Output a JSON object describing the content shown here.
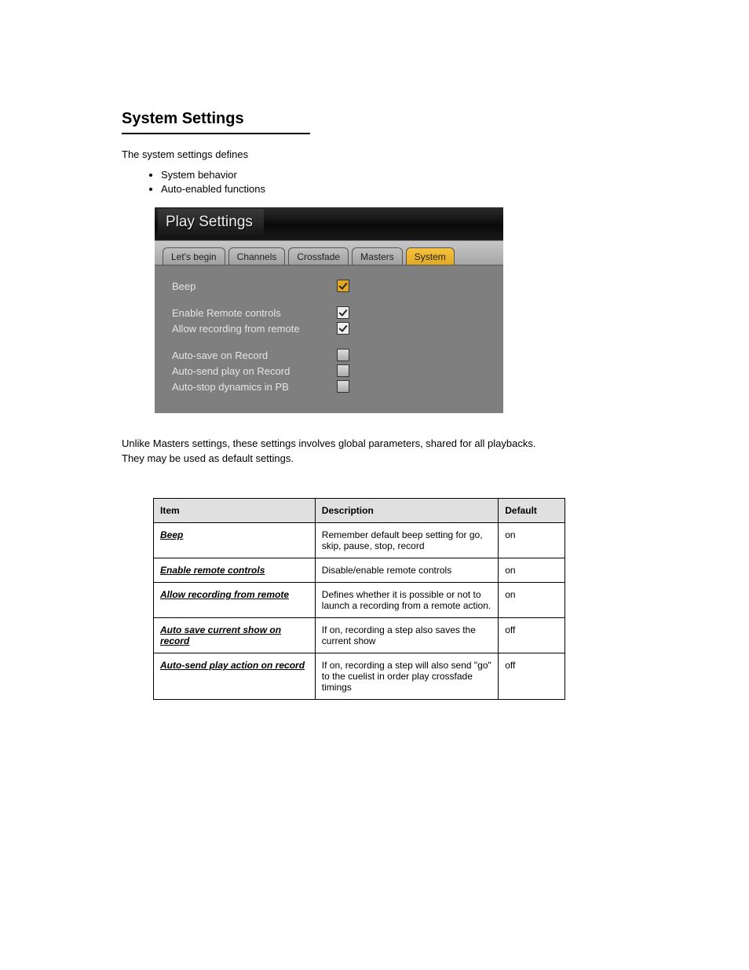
{
  "section_title": "System Settings",
  "intro": "The system settings defines",
  "bullets": [
    "System behavior",
    "Auto-enabled functions"
  ],
  "screenshot": {
    "window_title": "Play Settings",
    "tabs": [
      {
        "label": "Let's begin",
        "active": false
      },
      {
        "label": "Channels",
        "active": false
      },
      {
        "label": "Crossfade",
        "active": false
      },
      {
        "label": "Masters",
        "active": false
      },
      {
        "label": "System",
        "active": true
      }
    ],
    "options": [
      {
        "label": "Beep",
        "checked": true,
        "style": "orange"
      },
      {
        "_gap": true
      },
      {
        "label": "Enable Remote controls",
        "checked": true,
        "style": "white"
      },
      {
        "label": "Allow recording from remote",
        "checked": true,
        "style": "white"
      },
      {
        "_gap": true
      },
      {
        "label": "Auto-save on Record",
        "checked": false,
        "style": "off"
      },
      {
        "label": "Auto-send play on Record",
        "checked": false,
        "style": "off"
      },
      {
        "label": "Auto-stop dynamics in PB",
        "checked": false,
        "style": "off"
      }
    ]
  },
  "undertext_lines": [
    "Unlike Masters settings, these settings involves global parameters, shared for all playbacks.",
    "They may be used as default settings."
  ],
  "table": {
    "headers": [
      "Item",
      "Description",
      "Default"
    ],
    "rows": [
      {
        "item": "Beep",
        "desc": "Remember default beep setting for go, skip, pause, stop, record",
        "def": "on"
      },
      {
        "item": "Enable remote controls",
        "desc": "Disable/enable remote controls",
        "def": "on"
      },
      {
        "item": "Allow recording from remote",
        "desc": "Defines whether it is possible or not to launch a recording from a remote action.",
        "def": "on"
      },
      {
        "item": "Auto save current show on record",
        "desc": "If on, recording a step also saves the current show",
        "def": "off"
      },
      {
        "item": "Auto-send play action on record",
        "desc": "If on, recording a step will also send \"go\" to the cuelist in order play crossfade timings",
        "def": "off"
      }
    ]
  }
}
